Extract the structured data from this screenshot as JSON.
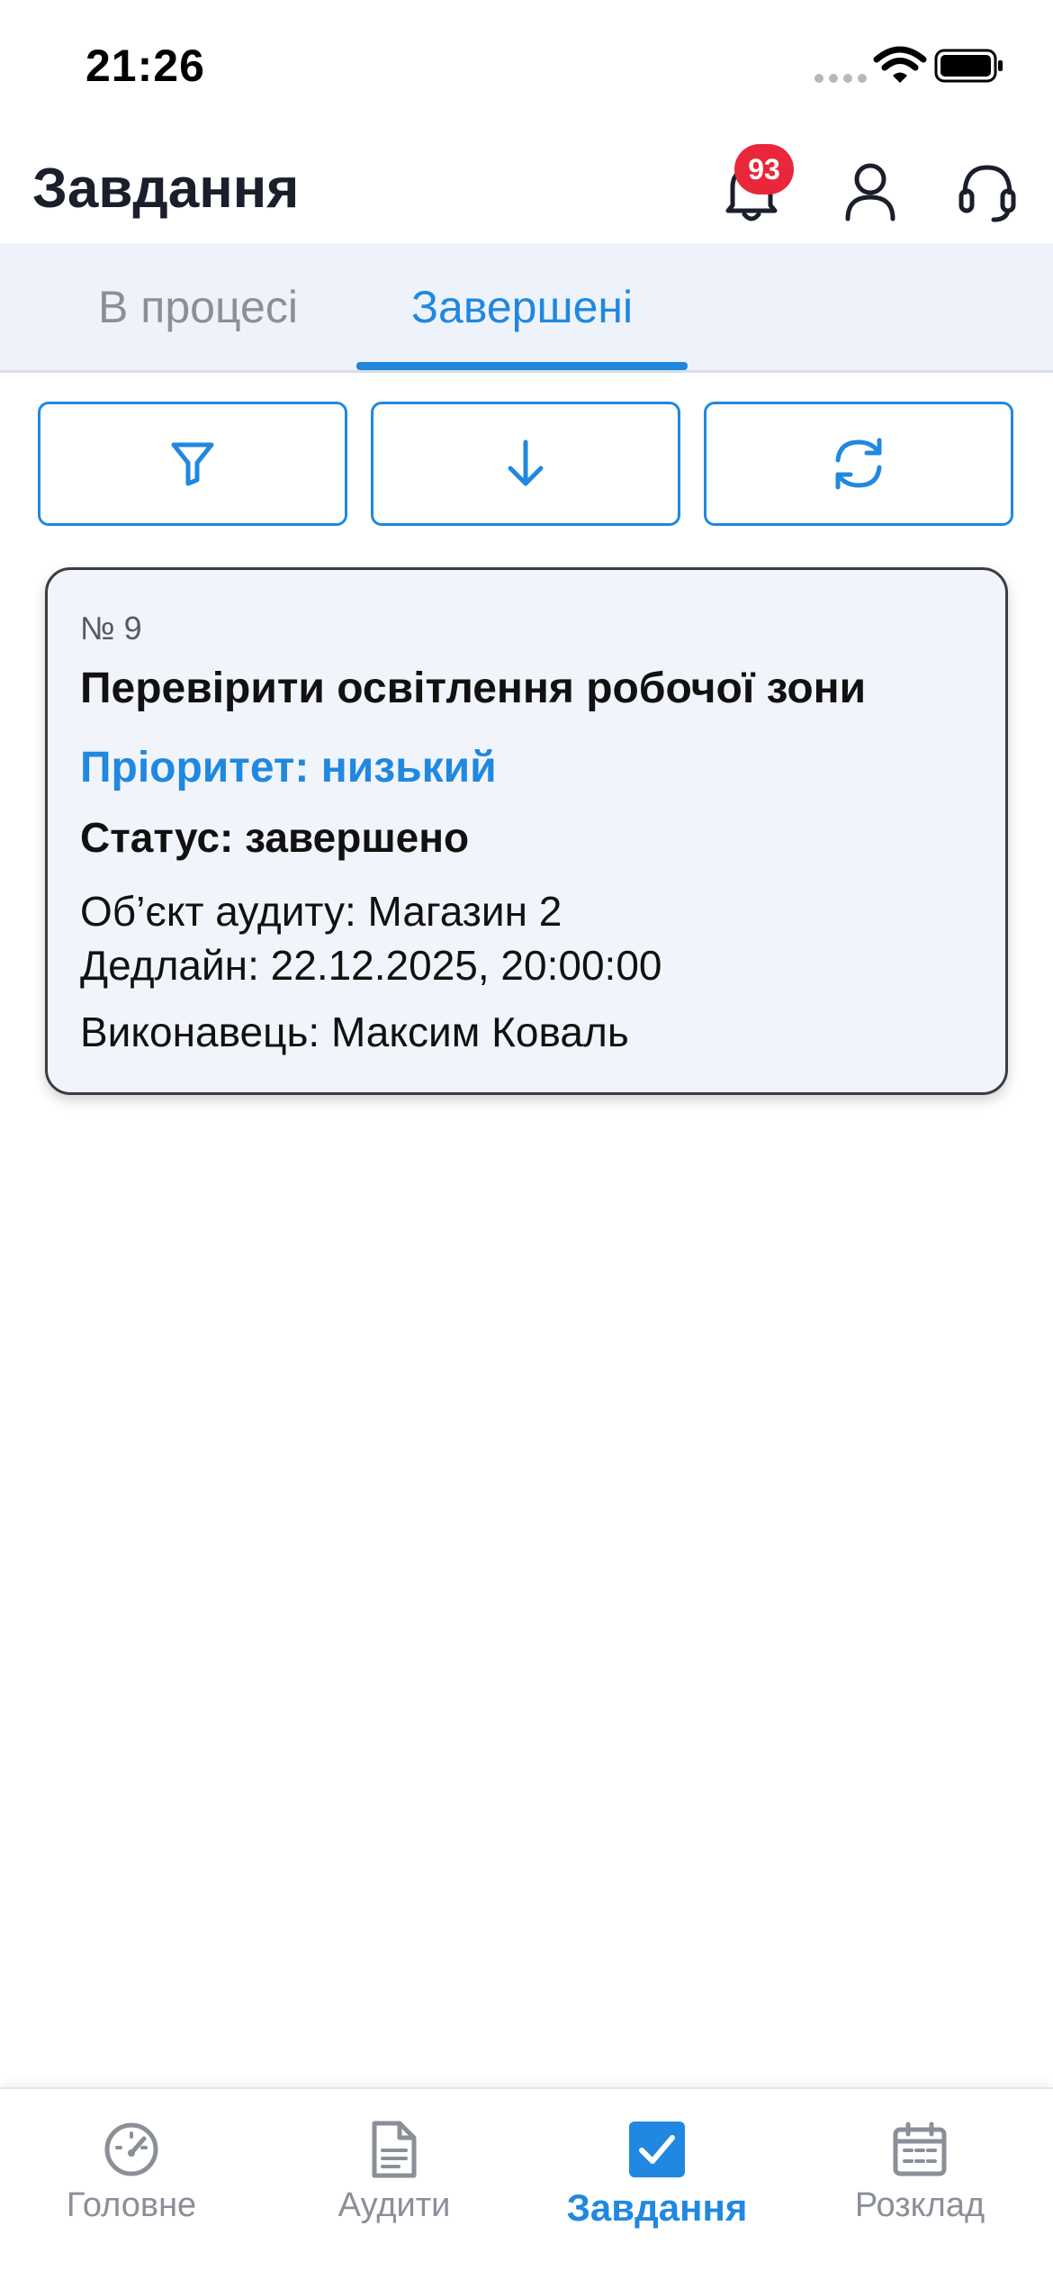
{
  "status_bar": {
    "time": "21:26"
  },
  "header": {
    "title": "Завдання",
    "notifications_count": "93"
  },
  "tabs": [
    {
      "label": "В процесі",
      "active": false
    },
    {
      "label": "Завершені",
      "active": true
    }
  ],
  "toolbar": {
    "filter_icon": "filter-icon",
    "sort_icon": "arrow-down-icon",
    "refresh_icon": "refresh-icon"
  },
  "tasks": [
    {
      "number": "№ 9",
      "title": "Перевірити освітлення робочої зони",
      "priority": "Пріоритет: низький",
      "status": "Статус: завершено",
      "audit_object": "Об’єкт аудиту: Магазин 2",
      "deadline": "Дедлайн: 22.12.2025, 20:00:00",
      "assignee": "Виконавець: Максим Коваль"
    }
  ],
  "bottom_nav": [
    {
      "label": "Головне",
      "icon": "speedometer-icon",
      "active": false
    },
    {
      "label": "Аудити",
      "icon": "document-icon",
      "active": false
    },
    {
      "label": "Завдання",
      "icon": "checkbox-icon",
      "active": true
    },
    {
      "label": "Розклад",
      "icon": "calendar-icon",
      "active": false
    }
  ],
  "colors": {
    "accent": "#2088e0",
    "badge": "#e8283a",
    "tab_bar_bg": "#eef3fb",
    "card_bg": "#f1f5fb",
    "inactive": "#8a8f98"
  }
}
